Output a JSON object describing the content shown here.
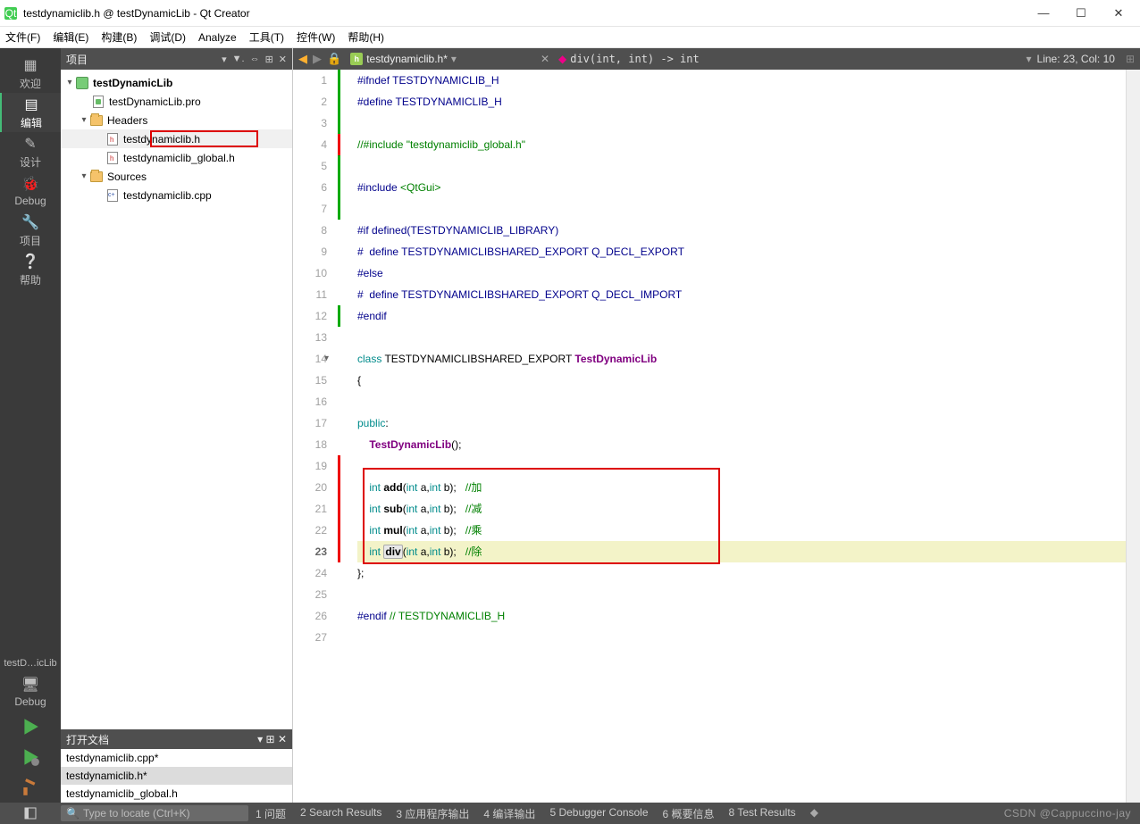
{
  "window": {
    "title": "testdynamiclib.h @ testDynamicLib - Qt Creator",
    "min": "—",
    "max": "☐",
    "close": "✕"
  },
  "menu": {
    "file": "文件(F)",
    "edit": "编辑(E)",
    "build": "构建(B)",
    "debug": "调试(D)",
    "analyze": "Analyze",
    "tools": "工具(T)",
    "widgets": "控件(W)",
    "help": "帮助(H)"
  },
  "leftbar": {
    "welcome": "欢迎",
    "edit": "编辑",
    "design": "设计",
    "debug": "Debug",
    "project": "项目",
    "help": "帮助",
    "projectLabel": "testD…icLib",
    "debugMode": "Debug"
  },
  "projectPanel": {
    "title": "项目",
    "tree": {
      "root": "testDynamicLib",
      "pro": "testDynamicLib.pro",
      "headers": "Headers",
      "h1": "testdynamiclib.h",
      "h2": "testdynamiclib_global.h",
      "sources": "Sources",
      "c1": "testdynamiclib.cpp"
    }
  },
  "openDocs": {
    "title": "打开文档",
    "d1": "testdynamiclib.cpp*",
    "d2": "testdynamiclib.h*",
    "d3": "testdynamiclib_global.h"
  },
  "editorTab": {
    "filename": "testdynamiclib.h*",
    "func": "div(int, int) -> int",
    "lineCol": "Line: 23, Col: 10"
  },
  "code": {
    "l1a": "#ifndef",
    "l1b": " TESTDYNAMICLIB_H",
    "l2a": "#define",
    "l2b": " TESTDYNAMICLIB_H",
    "l4": "//#include \"testdynamiclib_global.h\"",
    "l6a": "#include ",
    "l6b": "<QtGui>",
    "l8a": "#if",
    "l8b": " defined(TESTDYNAMICLIB_LIBRARY)",
    "l9a": "#  define",
    "l9b": " TESTDYNAMICLIBSHARED_EXPORT Q_DECL_EXPORT",
    "l10": "#else",
    "l11a": "#  define",
    "l11b": " TESTDYNAMICLIBSHARED_EXPORT Q_DECL_IMPORT",
    "l12": "#endif",
    "l14a": "class",
    "l14b": " TESTDYNAMICLIBSHARED_EXPORT ",
    "l14c": "TestDynamicLib",
    "l15": "{",
    "l17a": "public",
    "l17b": ":",
    "l18a": "    ",
    "l18b": "TestDynamicLib",
    "l18c": "();",
    "l20a": "    ",
    "l20b": "int ",
    "l20c": "add",
    "l20d": "(",
    "l20e": "int",
    "l20f": " a,",
    "l20g": "int",
    "l20h": " b);   ",
    "l20i": "//加",
    "l21c": "sub",
    "l21i": "//减",
    "l22c": "mul",
    "l22i": "//乘",
    "l23c": "div",
    "l23i": "//除",
    "l24": "};",
    "l26a": "#endif",
    "l26b": " // TESTDYNAMICLIB_H"
  },
  "bottombar": {
    "locator": "Type to locate (Ctrl+K)",
    "p1": "1 问题",
    "p2": "2 Search Results",
    "p3": "3 应用程序输出",
    "p4": "4 编译输出",
    "p5": "5 Debugger Console",
    "p6": "6 概要信息",
    "p8": "8 Test Results",
    "watermark": "CSDN @Cappuccino-jay"
  }
}
